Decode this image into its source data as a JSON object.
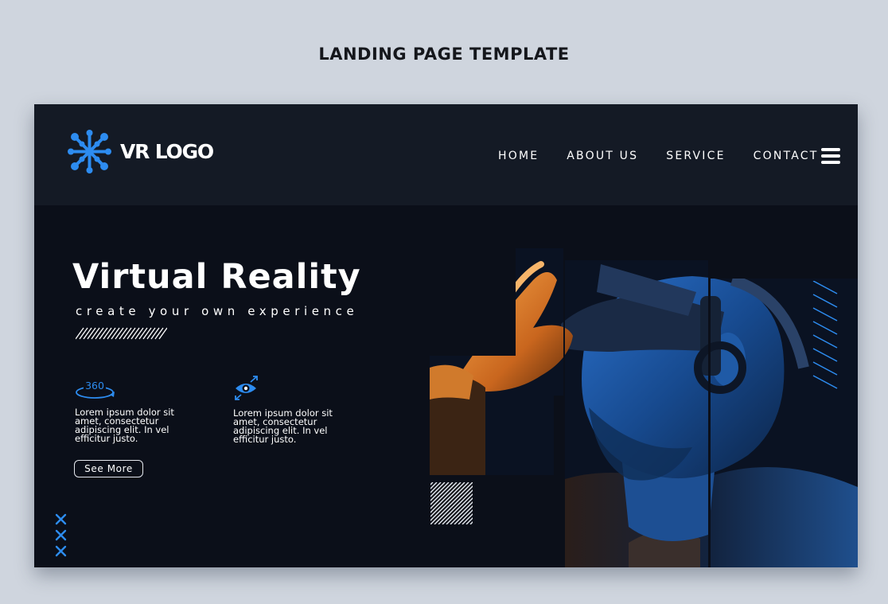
{
  "page_caption": "LANDING PAGE TEMPLATE",
  "header": {
    "logo_text": "VR LOGO",
    "nav": [
      "HOME",
      "ABOUT US",
      "SERVICE",
      "CONTACT"
    ]
  },
  "hero": {
    "title": "Virtual Reality",
    "subtitle": "create your own experience",
    "features": [
      {
        "icon": "360-view-icon",
        "icon_label": "360",
        "text": "Lorem ipsum dolor sit amet, consectetur adipiscing elit. In vel efficitur justo."
      },
      {
        "icon": "vr-eye-icon",
        "text": "Lorem ipsum dolor sit amet, consectetur adipiscing elit. In vel efficitur justo."
      }
    ],
    "button_label": "See More"
  },
  "colors": {
    "accent_blue": "#2d8cf0",
    "header_bg": "#141a25",
    "frame_bg": "#0b0f19",
    "page_bg": "#cfd5de"
  }
}
